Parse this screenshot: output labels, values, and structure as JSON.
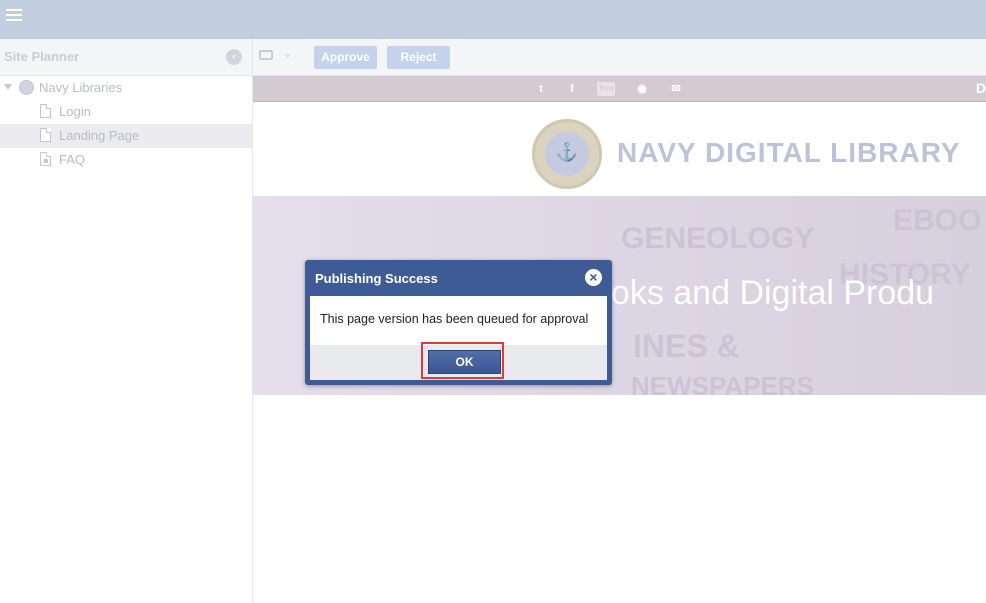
{
  "topbar": {
    "menu_icon": "hamburger-menu-icon"
  },
  "sidebar": {
    "title": "Site Planner",
    "collapse_icon": "chevron-left-icon",
    "tree": [
      {
        "label": "Navy Libraries",
        "icon": "globe-icon",
        "expanded": true
      },
      {
        "label": "Login",
        "icon": "page-icon"
      },
      {
        "label": "Landing Page",
        "icon": "page-icon",
        "selected": true
      },
      {
        "label": "FAQ",
        "icon": "locked-page-icon"
      }
    ]
  },
  "toolbar": {
    "device_icon": "monitor-icon",
    "approve_label": "Approve",
    "reject_label": "Reject"
  },
  "preview": {
    "social_icons": [
      "twitter-icon",
      "facebook-icon",
      "youtube-icon",
      "rss-icon",
      "email-icon"
    ],
    "social_glyphs": {
      "twitter": "t",
      "facebook": "f",
      "youtube": "You",
      "rss": "◉",
      "email": "✉"
    },
    "edge_glyph": "D",
    "site_title": "NAVY DIGITAL LIBRARY",
    "hero_text": "ooks and Digital Produ",
    "hero_words": [
      "GENEOLOGY",
      "EBOO",
      "HISTORY",
      "INES &",
      "NEWSPAPERS"
    ]
  },
  "dialog": {
    "title": "Publishing Success",
    "message": "This page version has been queued for approval",
    "ok_label": "OK",
    "close_icon": "close-circle-icon"
  },
  "colors": {
    "topbar": "#c2cde0",
    "dialog_header": "#3e5b96",
    "highlight_ring": "#e03a3a"
  }
}
